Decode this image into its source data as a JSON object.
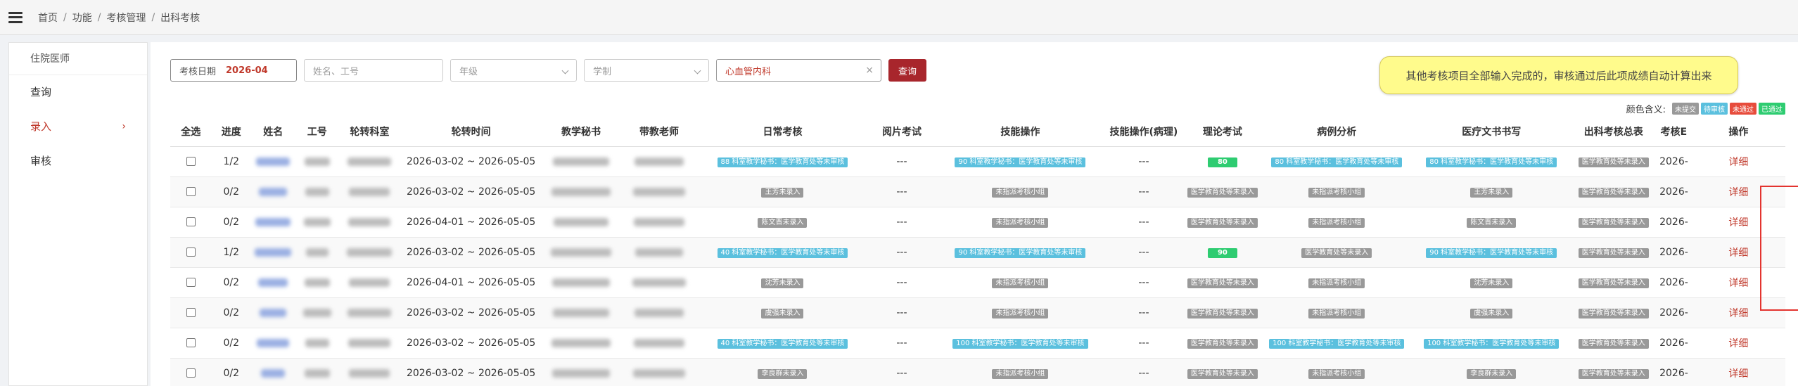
{
  "breadcrumb": [
    "首页",
    "功能",
    "考核管理",
    "出科考核"
  ],
  "sidebar": {
    "title": "住院医师",
    "items": [
      {
        "label": "查询",
        "active": false
      },
      {
        "label": "录入",
        "active": true,
        "chevron": "›"
      },
      {
        "label": "审核",
        "active": false
      }
    ]
  },
  "filters": {
    "date_label": "考核日期",
    "date_value": "2026-04",
    "name_placeholder": "姓名、工号",
    "grade_placeholder": "年级",
    "edu_placeholder": "学制",
    "dept_value": "心血管内科",
    "clear_icon": "×",
    "query_button": "查询"
  },
  "tip": "其他考核项目全部输入完成的，审核通过后此项成绩自动计算出来",
  "legend": {
    "title": "颜色含义:",
    "tags": [
      {
        "label": "未提交",
        "color": "#999999"
      },
      {
        "label": "待审核",
        "color": "#5bc0de"
      },
      {
        "label": "未通过",
        "color": "#e74c3c"
      },
      {
        "label": "已通过",
        "color": "#2ecc71"
      }
    ]
  },
  "table": {
    "headers": [
      "全选",
      "进度",
      "姓名",
      "工号",
      "轮转科室",
      "轮转时间",
      "教学秘书",
      "带教老师",
      "日常考核",
      "阅片考试",
      "技能操作",
      "技能操作(病理)",
      "理论考试",
      "病例分析",
      "医疗文书书写",
      "出科考核总表",
      "考核E",
      "操作"
    ],
    "rows": [
      {
        "progress": "1/2",
        "time": "2026-03-02 ~ 2026-05-05",
        "daily": {
          "text": "88  科室教学秘书：医学教育处等未审核",
          "color": "blue"
        },
        "reading": "---",
        "skill": {
          "text": "90  科室教学秘书：医学教育处等未审核",
          "color": "blue"
        },
        "skill_path": "---",
        "theory": {
          "text": "80",
          "color": "green"
        },
        "case": {
          "text": "80  科室教学秘书：医学教育处等未审核",
          "color": "blue"
        },
        "doc": {
          "text": "80  科室教学秘书：医学教育处等未审核",
          "color": "blue"
        },
        "summary": {
          "text": "医学教育处等未录入",
          "color": "gray"
        },
        "date": "2026-",
        "action": "详细"
      },
      {
        "progress": "0/2",
        "time": "2026-03-02 ~ 2026-05-05",
        "daily": {
          "text": "王芳未录入",
          "color": "gray"
        },
        "reading": "---",
        "skill": {
          "text": "未指派考核小组",
          "color": "gray"
        },
        "skill_path": "---",
        "theory": {
          "text": "医学教育处等未录入",
          "color": "gray"
        },
        "case": {
          "text": "未指派考核小组",
          "color": "gray"
        },
        "doc": {
          "text": "王芳未录入",
          "color": "gray"
        },
        "summary": {
          "text": "医学教育处等未录入",
          "color": "gray"
        },
        "date": "2026-",
        "action": "详细"
      },
      {
        "progress": "0/2",
        "time": "2026-04-01 ~ 2026-05-05",
        "daily": {
          "text": "陈文晋未录入",
          "color": "gray"
        },
        "reading": "---",
        "skill": {
          "text": "未指派考核小组",
          "color": "gray"
        },
        "skill_path": "---",
        "theory": {
          "text": "医学教育处等未录入",
          "color": "gray"
        },
        "case": {
          "text": "未指派考核小组",
          "color": "gray"
        },
        "doc": {
          "text": "陈文晋未录入",
          "color": "gray"
        },
        "summary": {
          "text": "医学教育处等未录入",
          "color": "gray"
        },
        "date": "2026-",
        "action": "详细"
      },
      {
        "progress": "1/2",
        "time": "2026-03-02 ~ 2026-05-05",
        "daily": {
          "text": "40  科室教学秘书：医学教育处等未审核",
          "color": "blue"
        },
        "reading": "---",
        "skill": {
          "text": "90  科室教学秘书：医学教育处等未审核",
          "color": "blue"
        },
        "skill_path": "---",
        "theory": {
          "text": "90",
          "color": "green"
        },
        "case": {
          "text": "医学教育处等未录入",
          "color": "gray"
        },
        "doc": {
          "text": "90  科室教学秘书：医学教育处等未审核",
          "color": "blue"
        },
        "summary": {
          "text": "医学教育处等未录入",
          "color": "gray"
        },
        "date": "2026-",
        "action": "详细"
      },
      {
        "progress": "0/2",
        "time": "2026-04-01 ~ 2026-05-05",
        "daily": {
          "text": "沈芳未录入",
          "color": "gray"
        },
        "reading": "---",
        "skill": {
          "text": "未指派考核小组",
          "color": "gray"
        },
        "skill_path": "---",
        "theory": {
          "text": "医学教育处等未录入",
          "color": "gray"
        },
        "case": {
          "text": "未指派考核小组",
          "color": "gray"
        },
        "doc": {
          "text": "沈芳未录入",
          "color": "gray"
        },
        "summary": {
          "text": "医学教育处等未录入",
          "color": "gray"
        },
        "date": "2026-",
        "action": "详细"
      },
      {
        "progress": "0/2",
        "time": "2026-03-02 ~ 2026-05-05",
        "daily": {
          "text": "虞强未录入",
          "color": "gray"
        },
        "reading": "---",
        "skill": {
          "text": "未指派考核小组",
          "color": "gray"
        },
        "skill_path": "---",
        "theory": {
          "text": "医学教育处等未录入",
          "color": "gray"
        },
        "case": {
          "text": "未指派考核小组",
          "color": "gray"
        },
        "doc": {
          "text": "虞强未录入",
          "color": "gray"
        },
        "summary": {
          "text": "医学教育处等未录入",
          "color": "gray"
        },
        "date": "2026-",
        "action": "详细"
      },
      {
        "progress": "0/2",
        "time": "2026-03-02 ~ 2026-05-05",
        "daily": {
          "text": "40  科室教学秘书：医学教育处等未审核",
          "color": "blue"
        },
        "reading": "---",
        "skill": {
          "text": "100  科室教学秘书：医学教育处等未审核",
          "color": "blue"
        },
        "skill_path": "---",
        "theory": {
          "text": "医学教育处等未录入",
          "color": "gray"
        },
        "case": {
          "text": "100  科室教学秘书：医学教育处等未审核",
          "color": "blue"
        },
        "doc": {
          "text": "100  科室教学秘书：医学教育处等未审核",
          "color": "blue"
        },
        "summary": {
          "text": "医学教育处等未录入",
          "color": "gray"
        },
        "date": "2026-",
        "action": "详细"
      },
      {
        "progress": "0/2",
        "time": "2026-03-02 ~ 2026-05-05",
        "daily": {
          "text": "李良群未录入",
          "color": "gray"
        },
        "reading": "---",
        "skill": {
          "text": "未指派考核小组",
          "color": "gray"
        },
        "skill_path": "---",
        "theory": {
          "text": "医学教育处等未录入",
          "color": "gray"
        },
        "case": {
          "text": "未指派考核小组",
          "color": "gray"
        },
        "doc": {
          "text": "李良群未录入",
          "color": "gray"
        },
        "summary": {
          "text": "医学教育处等未录入",
          "color": "gray"
        },
        "date": "2026-",
        "action": "详细"
      }
    ]
  }
}
